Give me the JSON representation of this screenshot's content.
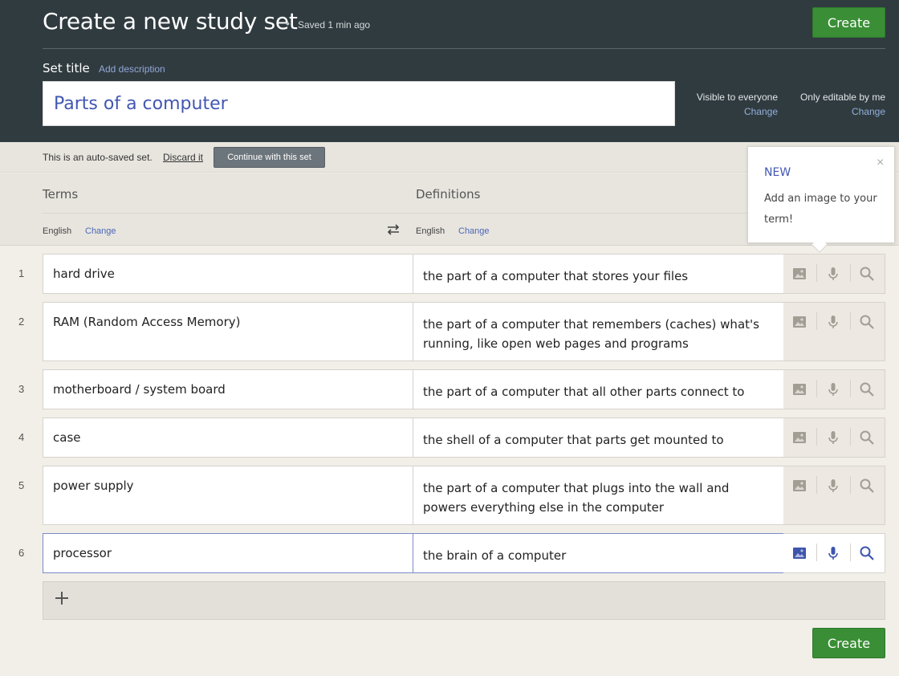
{
  "header": {
    "title": "Create a new study set",
    "saved_status": "Saved 1 min ago",
    "create_label": "Create",
    "set_title_label": "Set title",
    "add_description": "Add description",
    "title_value": "Parts of a computer",
    "visibility": {
      "label": "Visible to everyone",
      "change": "Change"
    },
    "editability": {
      "label": "Only editable by me",
      "change": "Change"
    }
  },
  "autosave": {
    "text": "This is an auto-saved set.",
    "discard": "Discard it",
    "continue_label": "Continue with this set"
  },
  "columns": {
    "terms": "Terms",
    "definitions": "Definitions",
    "term_language": "English",
    "definition_language": "English",
    "change": "Change"
  },
  "tooltip": {
    "badge": "NEW",
    "text": "Add an image to your term!",
    "close": "×"
  },
  "cards": [
    {
      "num": "1",
      "term": "hard drive",
      "definition": "the part of a computer that stores your files"
    },
    {
      "num": "2",
      "term": "RAM (Random Access Memory)",
      "definition": "the part of a computer that remembers (caches) what's running, like open web pages and programs"
    },
    {
      "num": "3",
      "term": "motherboard / system board",
      "definition": "the part of a computer that all other parts connect to"
    },
    {
      "num": "4",
      "term": "case",
      "definition": "the shell of a computer that parts get mounted to"
    },
    {
      "num": "5",
      "term": "power supply",
      "definition": "the part of a computer that plugs into the wall and powers everything else in the computer"
    },
    {
      "num": "6",
      "term": "processor",
      "definition": "the brain of a computer"
    }
  ],
  "footer": {
    "create_label": "Create"
  },
  "colors": {
    "header_bg": "#303b40",
    "create_green": "#3a8e35",
    "accent_blue": "#4257b2",
    "icon_inactive": "#a39e94",
    "icon_active": "#3e55ad"
  },
  "icons": [
    "image-icon",
    "microphone-icon",
    "search-icon",
    "swap-icon",
    "plus-icon",
    "close-icon"
  ]
}
